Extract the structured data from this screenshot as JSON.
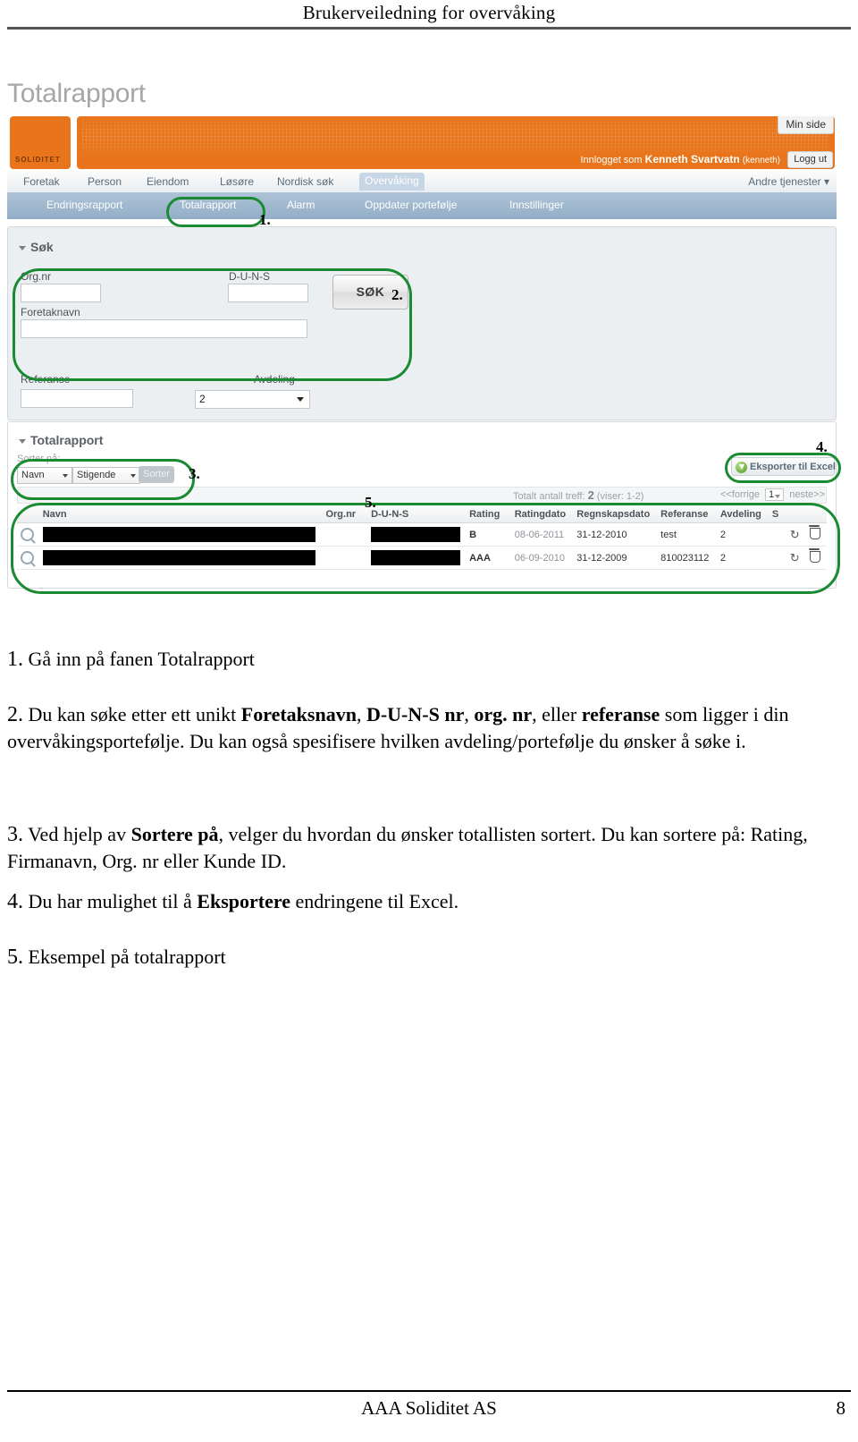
{
  "document": {
    "header_title": "Brukerveiledning for overvåking",
    "page_title": "Totalrapport",
    "footer_company": "AAA Soliditet AS",
    "footer_page_number": "8"
  },
  "app": {
    "brand_logo_text": "SOLIDITET",
    "min_side_label": "Min side",
    "logged_in_prefix": "Innlogget som",
    "logged_in_user": "Kenneth Svartvatn",
    "logged_in_userid": "(kenneth)",
    "logout_label": "Logg ut",
    "primary_nav": [
      {
        "label": "Foretak",
        "active": false
      },
      {
        "label": "Person",
        "active": false
      },
      {
        "label": "Eiendom",
        "active": false
      },
      {
        "label": "Løsøre",
        "active": false
      },
      {
        "label": "Nordisk søk",
        "active": false
      },
      {
        "label": "Overvåking",
        "active": true
      }
    ],
    "primary_nav_right": "Andre tjenester",
    "secondary_nav": [
      {
        "label": "Endringsrapport",
        "selected": false
      },
      {
        "label": "Totalrapport",
        "selected": true
      },
      {
        "label": "Alarm",
        "selected": false
      },
      {
        "label": "Oppdater portefølje",
        "selected": false
      },
      {
        "label": "Innstillinger",
        "selected": false
      }
    ],
    "search_panel": {
      "title": "Søk",
      "orgnr_label": "Org.nr",
      "orgnr_value": "",
      "duns_label": "D-U-N-S",
      "duns_value": "",
      "foretaknavn_label": "Foretaknavn",
      "foretaknavn_value": "",
      "referanse_label": "Referanse",
      "referanse_value": "",
      "avdeling_label": "Avdeling",
      "avdeling_value": "2",
      "search_button_label": "SØK"
    },
    "report_panel": {
      "title": "Totalrapport",
      "sort_label": "Sorter på:",
      "sort_field_value": "Navn",
      "sort_order_value": "Stigende",
      "sort_button_label": "Sorter",
      "export_button_label": "Eksporter til Excel",
      "result_count_text": "Totalt antall treff:",
      "result_count_value": "2",
      "result_range_text": "(viser: 1-2)",
      "prev_label": "<<forrige",
      "page_value": "1",
      "next_label": "neste>>",
      "columns": [
        "Navn",
        "Org.nr",
        "D-U-N-S",
        "Rating",
        "Ratingdato",
        "Regnskapsdato",
        "Referanse",
        "Avdeling",
        "S"
      ],
      "rows": [
        {
          "navn": "",
          "orgnr": "",
          "duns": "",
          "rating": "B",
          "ratingdato": "08-06-2011",
          "regnskapsdato": "31-12-2010",
          "referanse": "test",
          "avdeling": "2",
          "s": ""
        },
        {
          "navn": "",
          "orgnr": "",
          "duns": "",
          "rating": "AAA",
          "ratingdato": "06-09-2010",
          "regnskapsdato": "31-12-2009",
          "referanse": "810023112",
          "avdeling": "2",
          "s": ""
        }
      ]
    },
    "callouts": {
      "c1": "1.",
      "c2": "2.",
      "c3": "3.",
      "c4": "4.",
      "c5": "5."
    },
    "accent_green": "#1a8a33",
    "accent_orange": "#e8751b"
  },
  "instructions": [
    {
      "number": "1.",
      "parts": [
        {
          "t": " Gå inn på fanen Totalrapport",
          "b": false
        }
      ]
    },
    {
      "number": "2.",
      "parts": [
        {
          "t": " Du kan søke etter ett unikt ",
          "b": false
        },
        {
          "t": "Foretaksnavn",
          "b": true
        },
        {
          "t": ", ",
          "b": false
        },
        {
          "t": "D-U-N-S nr",
          "b": true
        },
        {
          "t": ", ",
          "b": false
        },
        {
          "t": "org. nr",
          "b": true
        },
        {
          "t": ", eller ",
          "b": false
        },
        {
          "t": "referanse",
          "b": true
        },
        {
          "t": " som ligger i din overvåkingsportefølje. Du kan også spesifisere hvilken avdeling/portefølje du ønsker å søke i.",
          "b": false
        }
      ]
    },
    {
      "number": "3.",
      "parts": [
        {
          "t": " Ved hjelp av ",
          "b": false
        },
        {
          "t": "Sortere på",
          "b": true
        },
        {
          "t": ", velger du hvordan du ønsker totallisten sortert. Du kan sortere på: Rating, Firmanavn, Org. nr eller Kunde ID.",
          "b": false
        }
      ]
    },
    {
      "number": "4.",
      "parts": [
        {
          "t": " Du har mulighet til å ",
          "b": false
        },
        {
          "t": "Eksportere",
          "b": true
        },
        {
          "t": " endringene til Excel.",
          "b": false
        }
      ]
    },
    {
      "number": "5.",
      "parts": [
        {
          "t": " Eksempel på totalrapport",
          "b": false
        }
      ]
    }
  ]
}
